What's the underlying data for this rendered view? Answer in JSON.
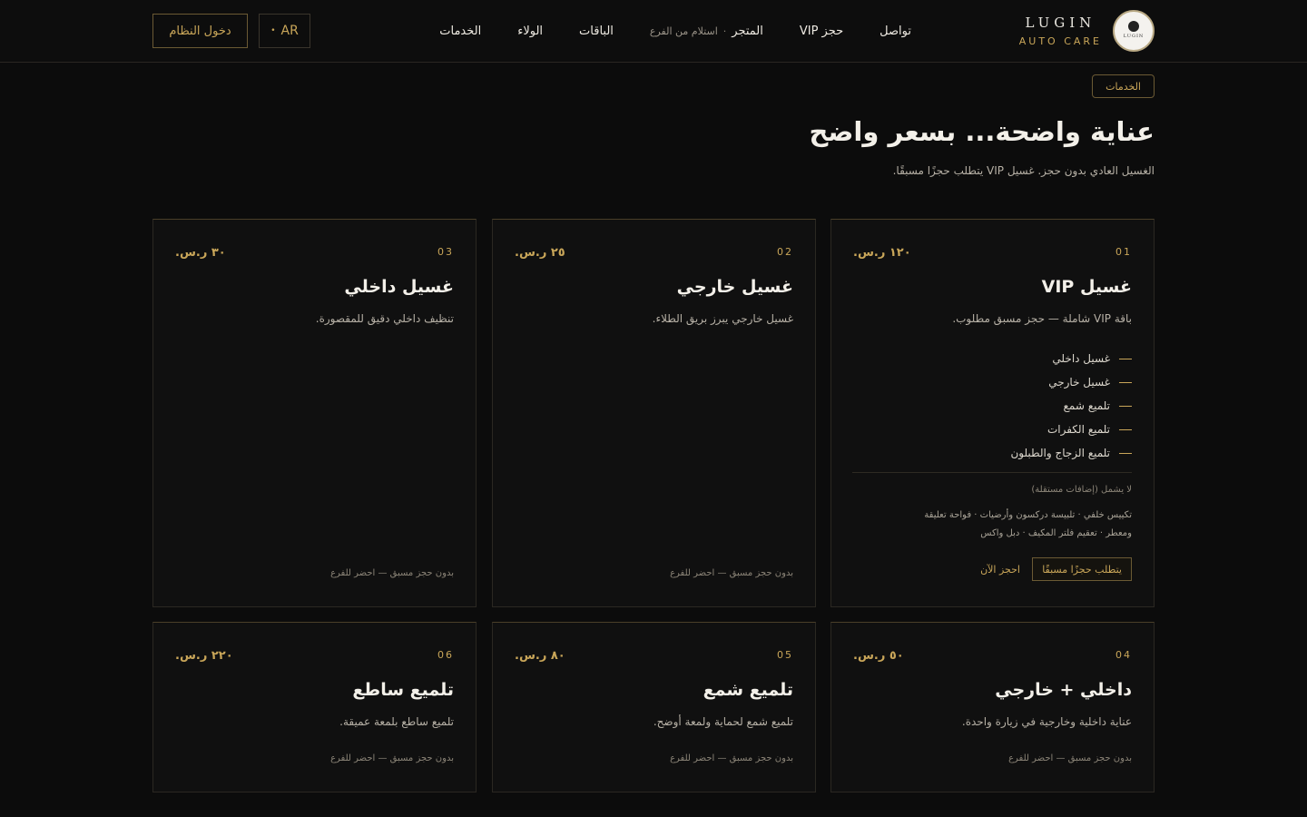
{
  "brand": {
    "name": "LUGIN",
    "subtitle": "AUTO CARE",
    "logo_text": "LUGIN"
  },
  "nav": {
    "services": "الخدمات",
    "loyalty": "الولاء",
    "packages": "الباقات",
    "store": "المتجر",
    "store_separator": "·",
    "store_pickup": "استلام من الفرع",
    "vip_booking": "حجز VIP",
    "contact": "تواصل"
  },
  "header": {
    "lang_label": "AR",
    "lang_dot": "•",
    "login_label": "دخول النظام"
  },
  "hero": {
    "badge": "الخدمات",
    "title": "عناية واضحة... بسعر واضح",
    "subtitle": "الغسيل العادي بدون حجز. غسيل VIP يتطلب حجزًا مسبقًا."
  },
  "cards": [
    {
      "number": "01",
      "price": "١٢٠ ر.س.",
      "title": "غسيل VIP",
      "description": "باقة VIP شاملة — حجز مسبق مطلوب.",
      "features": [
        "غسيل داخلي",
        "غسيل خارجي",
        "تلميع شمع",
        "تلميع الكفرات",
        "تلميع الزجاج والطبلون"
      ],
      "exclusions_label": "لا يشمل (إضافات مستقلة)",
      "exclusions_line1": "تكييس خلفي · تلبيسة دركسون وأرضيات · فواحة تعليقة",
      "exclusions_line2": "ومعطر · تعقيم فلتر المكيف · دبل واكس",
      "requires_booking": "يتطلب حجزًا مسبقًا",
      "book_now": "احجز الآن"
    },
    {
      "number": "02",
      "price": "٢٥ ر.س.",
      "title": "غسيل خارجي",
      "description": "غسيل خارجي يبرز بريق الطلاء.",
      "footnote": "بدون حجز مسبق — احضر للفرع"
    },
    {
      "number": "03",
      "price": "٣٠ ر.س.",
      "title": "غسيل داخلي",
      "description": "تنظيف داخلي دقيق للمقصورة.",
      "footnote": "بدون حجز مسبق — احضر للفرع"
    },
    {
      "number": "04",
      "price": "٥٠ ر.س.",
      "title": "داخلي + خارجي",
      "description": "عناية داخلية وخارجية في زيارة واحدة.",
      "footnote": "بدون حجز مسبق — احضر للفرع"
    },
    {
      "number": "05",
      "price": "٨٠ ر.س.",
      "title": "تلميع شمع",
      "description": "تلميع شمع لحماية ولمعة أوضح.",
      "footnote": "بدون حجز مسبق — احضر للفرع"
    },
    {
      "number": "06",
      "price": "٢٢٠ ر.س.",
      "title": "تلميع ساطع",
      "description": "تلميع ساطع بلمعة عميقة.",
      "footnote": "بدون حجز مسبق — احضر للفرع"
    }
  ],
  "colors": {
    "background": "#0c0c0c",
    "accent_gold": "#c9a659",
    "card_bg": "#101010",
    "border": "#2b2822"
  }
}
